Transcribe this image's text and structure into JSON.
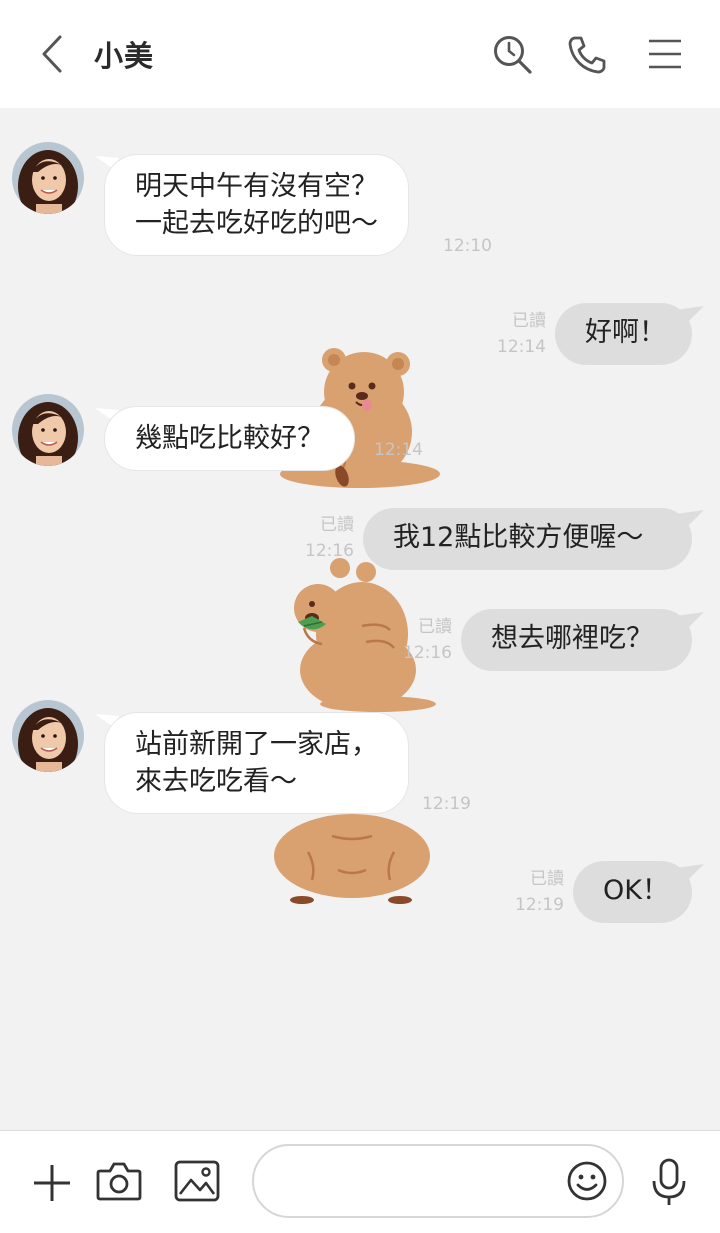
{
  "header": {
    "contact_name": "小美"
  },
  "messages": [
    {
      "side": "in",
      "lines": [
        "明天中午有沒有空？",
        "一起去吃好吃的吧～"
      ],
      "time": "12:10"
    },
    {
      "side": "out",
      "text": "好啊！",
      "read": "已讀",
      "time": "12:14"
    },
    {
      "side": "in",
      "text": "幾點吃比較好？",
      "time": "12:14"
    },
    {
      "side": "out",
      "text": "我12點比較方便喔～",
      "read": "已讀",
      "time": "12:16"
    },
    {
      "side": "out",
      "text": "想去哪裡吃？",
      "read": "已讀",
      "time": "12:16"
    },
    {
      "side": "in",
      "lines": [
        "站前新開了一家店，",
        "來去吃吃看～"
      ],
      "time": "12:19"
    },
    {
      "side": "out",
      "text": "OK！",
      "read": "已讀",
      "time": "12:19"
    }
  ],
  "input": {
    "value": ""
  },
  "colors": {
    "background": "#f2f2f2",
    "incoming_bubble": "#ffffff",
    "outgoing_bubble": "#dddddd",
    "sticker": "#d9a070",
    "meta_text": "#c5c5c5"
  },
  "icons": {
    "back": "chevron-left-icon",
    "search": "search-history-icon",
    "call": "phone-icon",
    "menu": "menu-icon",
    "add": "plus-icon",
    "camera": "camera-icon",
    "image": "image-icon",
    "emoji": "smiley-icon",
    "voice": "microphone-icon"
  }
}
